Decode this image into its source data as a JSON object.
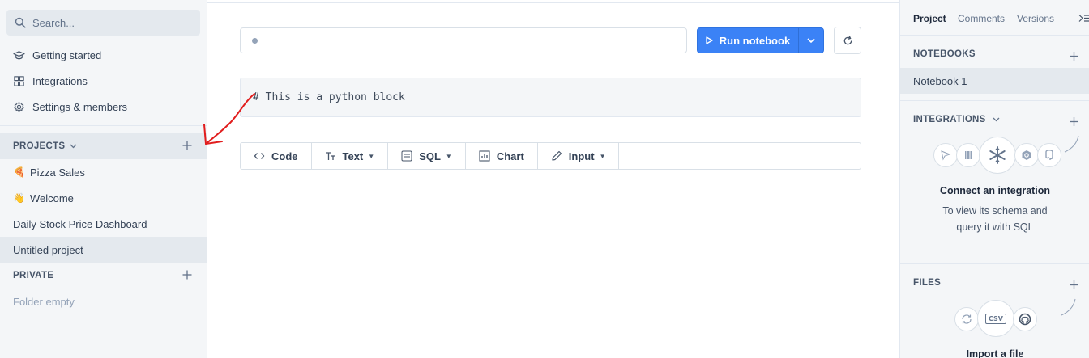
{
  "sidebar": {
    "search_placeholder": "Search...",
    "nav": [
      {
        "label": "Getting started",
        "icon": "graduation-cap-icon"
      },
      {
        "label": "Integrations",
        "icon": "grid-icon"
      },
      {
        "label": "Settings & members",
        "icon": "gear-icon"
      }
    ],
    "projects_heading": "PROJECTS",
    "projects": [
      {
        "emoji": "🍕",
        "label": "Pizza Sales"
      },
      {
        "emoji": "👋",
        "label": "Welcome"
      },
      {
        "emoji": "",
        "label": "Daily Stock Price Dashboard"
      },
      {
        "emoji": "",
        "label": "Untitled project"
      }
    ],
    "private_heading": "PRIVATE",
    "private_empty": "Folder empty"
  },
  "main": {
    "run_label": "Run notebook",
    "code_text": "# This is a python block",
    "toolbar": [
      {
        "label": "Code",
        "icon": "code-icon"
      },
      {
        "label": "Text",
        "icon": "text-icon"
      },
      {
        "label": "SQL",
        "icon": "sql-icon"
      },
      {
        "label": "Chart",
        "icon": "chart-icon"
      },
      {
        "label": "Input",
        "icon": "pencil-icon"
      }
    ]
  },
  "right_panel": {
    "tabs": [
      "Project",
      "Comments",
      "Versions"
    ],
    "notebooks_heading": "NOTEBOOKS",
    "notebook_item": "Notebook 1",
    "integrations_heading": "INTEGRATIONS",
    "integrations_title": "Connect an integration",
    "integrations_sub1": "To view its schema and",
    "integrations_sub2": "query it with SQL",
    "files_heading": "FILES",
    "files_title": "Import a file",
    "csv_label": "CSV"
  },
  "colors": {
    "accent": "#3b82f6",
    "annotation_arrow": "#e11d1d"
  }
}
